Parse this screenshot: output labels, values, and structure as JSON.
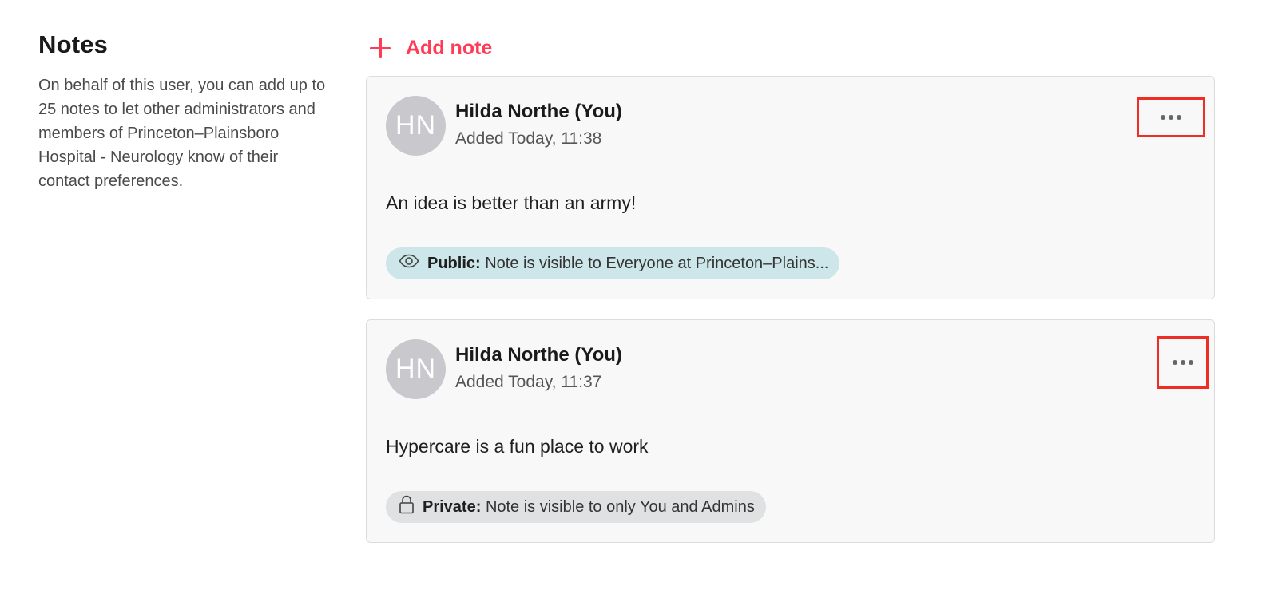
{
  "sidebar": {
    "title": "Notes",
    "description": "On behalf of this user, you can add up to 25 notes to let other administrators and members of Princeton–Plainsboro Hospital - Neurology know of their contact preferences."
  },
  "add_note": {
    "label": "Add note",
    "icon": "plus-icon",
    "color": "#ff3c55"
  },
  "notes": [
    {
      "avatar_initials": "HN",
      "author": "Hilda Northe (You)",
      "added": "Added Today, 11:38",
      "body": "An idea is better than an army!",
      "visibility": {
        "icon": "eye-icon",
        "label": "Public:",
        "text": "Note is visible to Everyone at Princeton–Plains...",
        "color": "#cce6e9"
      },
      "menu_icon": "more-horizontal-icon"
    },
    {
      "avatar_initials": "HN",
      "author": "Hilda Northe (You)",
      "added": "Added Today, 11:37",
      "body": "Hypercare is a fun place to work",
      "visibility": {
        "icon": "lock-icon",
        "label": "Private:",
        "text": "Note is visible to only You and Admins",
        "color": "#dfe1e3"
      },
      "menu_icon": "more-horizontal-icon"
    }
  ],
  "highlight_color": "#ee2d24"
}
